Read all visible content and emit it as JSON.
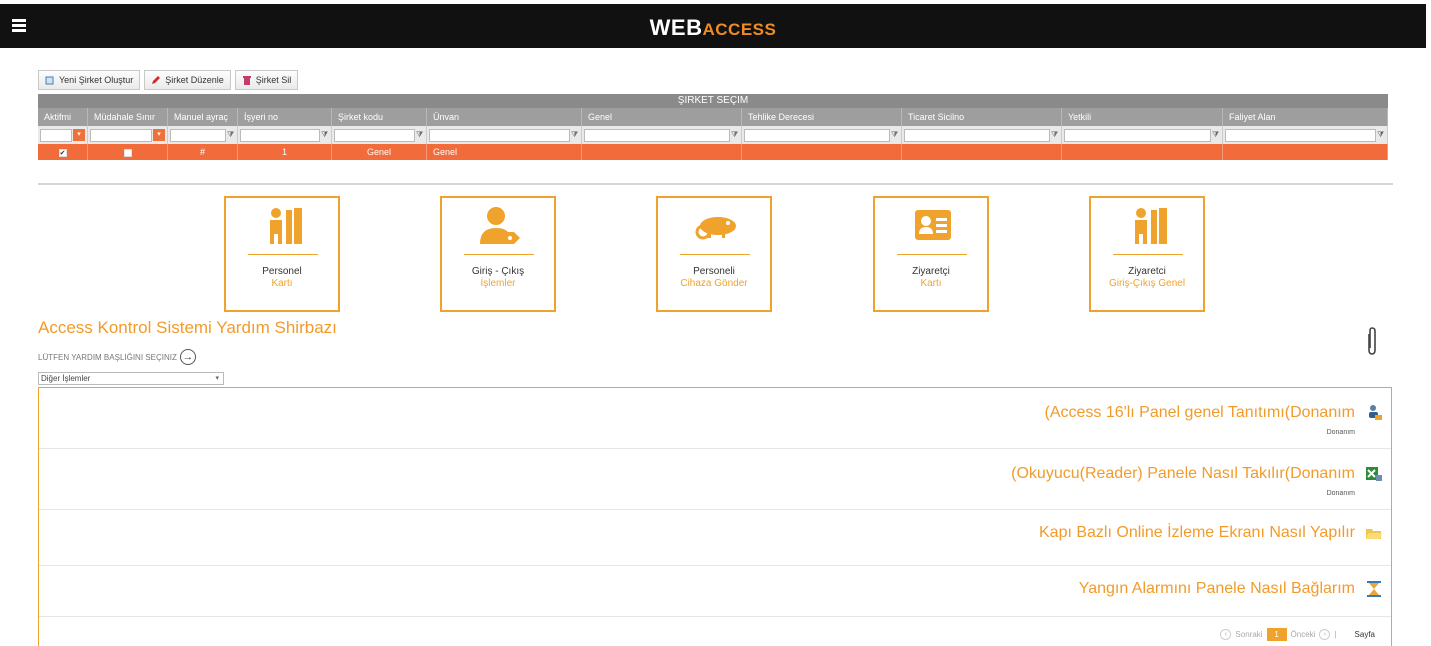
{
  "header": {
    "brand_main": "WEB",
    "brand_accent": "ACCESS"
  },
  "toolbar": {
    "create_label": "Yeni Şirket Oluştur",
    "edit_label": "Şirket Düzenle",
    "delete_label": "Şirket Sil"
  },
  "grid": {
    "title": "ŞIRKET SEÇIM",
    "columns": [
      "Aktifmi",
      "Müdahale Sınır",
      "Manuel ayraç",
      "İşyeri no",
      "Şirket kodu",
      "Ünvan",
      "Genel",
      "Tehlike Derecesi",
      "Ticaret Sicilno",
      "Yetkili",
      "Faliyet Alan"
    ],
    "row": {
      "manuel": "#",
      "isyeri": "1",
      "kod": "Genel",
      "unvan": "Genel"
    }
  },
  "tiles": [
    {
      "line1": "Personel",
      "line2": "Kartı",
      "icon": "person-file-icon"
    },
    {
      "line1": "Giriş - Çıkış",
      "line2": "İşlemler",
      "icon": "user-tag-icon"
    },
    {
      "line1": "Personeli",
      "line2": "Cihaza Gönder",
      "icon": "chameleon-icon"
    },
    {
      "line1": "Ziyaretçi",
      "line2": "Kartı",
      "icon": "id-card-icon"
    },
    {
      "line1": "Ziyaretci",
      "line2": "Giriş-Çıkış Genel",
      "icon": "person-file-icon"
    }
  ],
  "help": {
    "title": "Access Kontrol Sistemi Yardım Shirbazı",
    "subtitle": "LÜTFEN YARDIM BAŞLIĞINI SEÇINIZ",
    "selected": "Diğer İşlemler"
  },
  "items": [
    {
      "title": "(Access 16'lı Panel genel Tanıtımı(Donanım",
      "category": "Donanım",
      "icon": "hardware-user-icon"
    },
    {
      "title": "(Okuyucu(Reader) Panele Nasıl Takılır(Donanım",
      "category": "Donanım",
      "icon": "excel-icon"
    },
    {
      "title": "Kapı Bazlı Online İzleme Ekranı Nasıl Yapılır",
      "category": "",
      "icon": "folder-icon"
    },
    {
      "title": "Yangın Alarmını Panele Nasıl Bağlarım",
      "category": "",
      "icon": "hourglass-icon"
    }
  ],
  "pager": {
    "next": "Sonraki",
    "page": "1",
    "prev": "Önceki",
    "sep": "|",
    "label": "Sayfa"
  },
  "colors": {
    "accent": "#f0a32c",
    "row": "#f26b3a",
    "topbar": "#111111"
  }
}
